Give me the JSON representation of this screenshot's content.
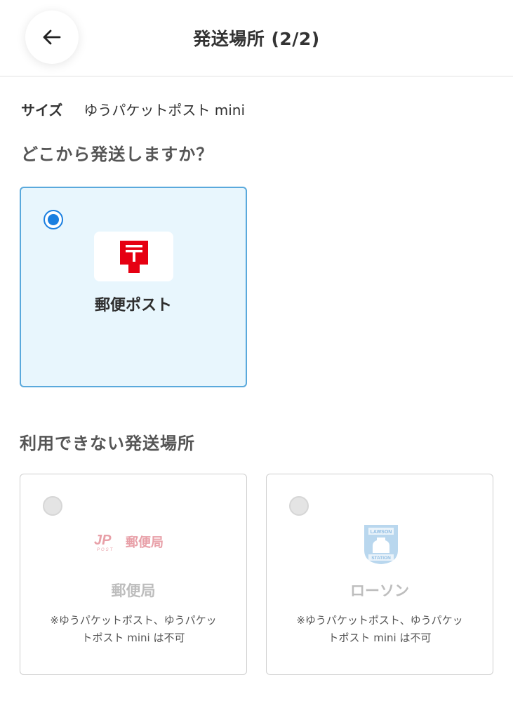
{
  "header": {
    "title": "発送場所 (2/2)",
    "back_icon": "arrow-left-icon"
  },
  "size": {
    "label": "サイズ",
    "value": "ゆうパケットポスト mini"
  },
  "question": "どこから発送しますか？",
  "available_options": [
    {
      "name": "郵便ポスト",
      "selected": true,
      "icon": "post-box-icon",
      "accent_color": "#e60012"
    }
  ],
  "unavailable": {
    "heading": "利用できない発送場所",
    "options": [
      {
        "name": "郵便局",
        "logo_text": "郵便局",
        "logo_mark": "JP",
        "logo_sub": "POST",
        "note_line1": "※ゆうパケットポスト、ゆうパケッ",
        "note_line2": "トポスト mini は不可",
        "icon": "japan-post-logo-icon"
      },
      {
        "name": "ローソン",
        "logo_top": "LAWSON",
        "logo_bottom": "STATION",
        "note_line1": "※ゆうパケットポスト、ゆうパケッ",
        "note_line2": "トポスト mini は不可",
        "icon": "lawson-logo-icon"
      }
    ]
  },
  "colors": {
    "selected_bg": "#e8f6fd",
    "selected_border": "#5aa9dc",
    "radio_on": "#1a7fe0"
  }
}
